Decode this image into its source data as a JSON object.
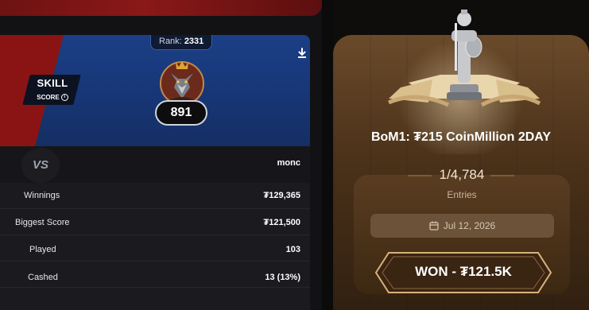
{
  "profile": {
    "rank_label": "Rank:",
    "rank_value": "2331",
    "skill_title": "SKILL",
    "skill_sub": "SCORE",
    "score": "891"
  },
  "versus": {
    "vs_label": "VS",
    "opponent": "monc"
  },
  "stats": [
    {
      "label": "Winnings",
      "value": "₮129,365"
    },
    {
      "label": "Biggest Score",
      "value": "₮121,500"
    },
    {
      "label": "Played",
      "value": "103"
    },
    {
      "label": "Cashed",
      "value": "13 (13%)"
    }
  ],
  "tournament": {
    "title": "BoM1: ₮215 CoinMillion 2DAY",
    "entries": "1/4,784",
    "entries_label": "Entries",
    "date": "Jul 12, 2026",
    "result": "WON - ₮121.5K"
  },
  "icons": {
    "download": "download-icon",
    "info": "info-icon",
    "calendar": "calendar-icon"
  },
  "colors": {
    "blue_panel": "#1b3f86",
    "red_panel": "#8a1414",
    "wood": "#4a3119",
    "gold_accent": "#d9b27a"
  }
}
